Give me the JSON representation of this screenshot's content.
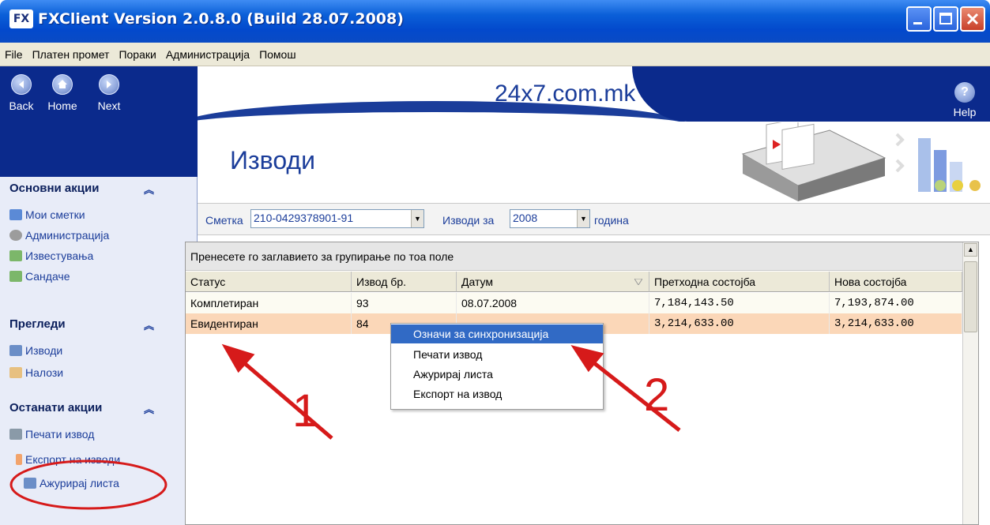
{
  "window": {
    "logo_text": "FX",
    "title": "FXClient Version 2.0.8.0 (Build 28.07.2008)"
  },
  "menubar": {
    "items": [
      "File",
      "Платен промет",
      "Пораки",
      "Администрација",
      "Помош"
    ]
  },
  "nav": {
    "back": "Back",
    "home": "Home",
    "next": "Next",
    "help": "Help",
    "help_glyph": "?"
  },
  "banner": {
    "site": "24x7.com.mk"
  },
  "sidebar": {
    "sections": [
      {
        "title": "Основни акции",
        "items": [
          "Мои сметки",
          "Администрација",
          "Известувања",
          "Сандаче"
        ]
      },
      {
        "title": "Прегледи",
        "items": [
          "Изводи",
          "Налози"
        ]
      },
      {
        "title": "Останати акции",
        "items": [
          "Печати извод",
          "Експорт на изводи",
          "Ажурирај листа"
        ]
      }
    ]
  },
  "main": {
    "title": "Изводи"
  },
  "filter": {
    "account_label": "Сметка",
    "account_value": "210-0429378901-91",
    "year_label": "Изводи за",
    "year_value": "2008",
    "year_suffix": "година"
  },
  "grid": {
    "group_hint": "Пренесете го заглавието за групирање по тоа поле",
    "columns": [
      "Статус",
      "Извод бр.",
      "Датум",
      "Претходна состојба",
      "Нова состојба"
    ],
    "rows": [
      [
        "Комплетиран",
        "93",
        "08.07.2008",
        "7,184,143.50",
        "7,193,874.00"
      ],
      [
        "Евидентиран",
        "84",
        "",
        "3,214,633.00",
        "3,214,633.00"
      ]
    ]
  },
  "context_menu": {
    "items": [
      "Означи за синхронизација",
      "Печати извод",
      "Ажурирај листа",
      "Експорт на извод"
    ],
    "selected_index": 0
  },
  "annotations": {
    "label_1": "1",
    "label_2": "2",
    "arrow_color": "#d61a1a"
  },
  "colors": {
    "title_bar": "#0a5fd8",
    "nav_panel": "#0b2a8c",
    "selected_row": "#fbd7b8",
    "menu_selection": "#316ac5"
  }
}
